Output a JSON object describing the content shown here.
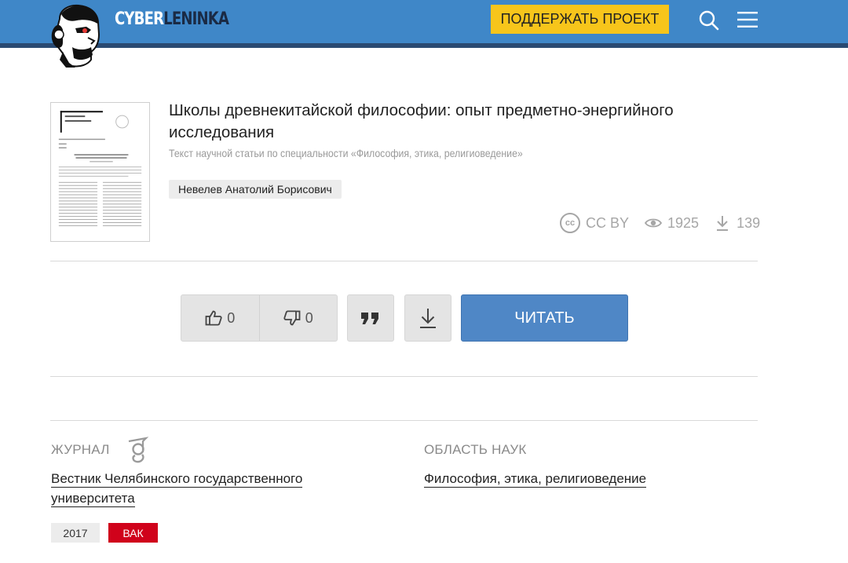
{
  "header": {
    "logo_text_a": "CYBER",
    "logo_text_b": "LENINKA",
    "support_label": "ПОДДЕРЖАТЬ ПРОЕКТ",
    "search_icon": "search-icon",
    "menu_icon": "hamburger-menu-icon"
  },
  "article": {
    "title": "Школы древнекитайской философии: опыт предметно-энергийного исследования",
    "subtitle": "Текст научной статьи по специальности «Философия, этика, религиоведение»",
    "author": "Невелев Анатолий Борисович",
    "license_icon_text": "cc",
    "license": "CC BY",
    "views": "1925",
    "downloads": "139"
  },
  "actions": {
    "likes": "0",
    "dislikes": "0",
    "read_label": "ЧИТАТЬ",
    "icons": [
      "thumbs-up-icon",
      "thumbs-down-icon",
      "quote-icon",
      "download-icon"
    ]
  },
  "journal": {
    "label": "ЖУРНАЛ",
    "name": "Вестник Челябинского государственного университета",
    "year": "2017",
    "badge": "ВАК"
  },
  "field": {
    "label": "ОБЛАСТЬ НАУК",
    "name": "Философия, этика, религиоведение"
  },
  "colors": {
    "header_bg": "#3f87c8",
    "support_bg": "#f7c51b",
    "read_bg": "#4f87c6",
    "vak_bg": "#d0021b"
  }
}
